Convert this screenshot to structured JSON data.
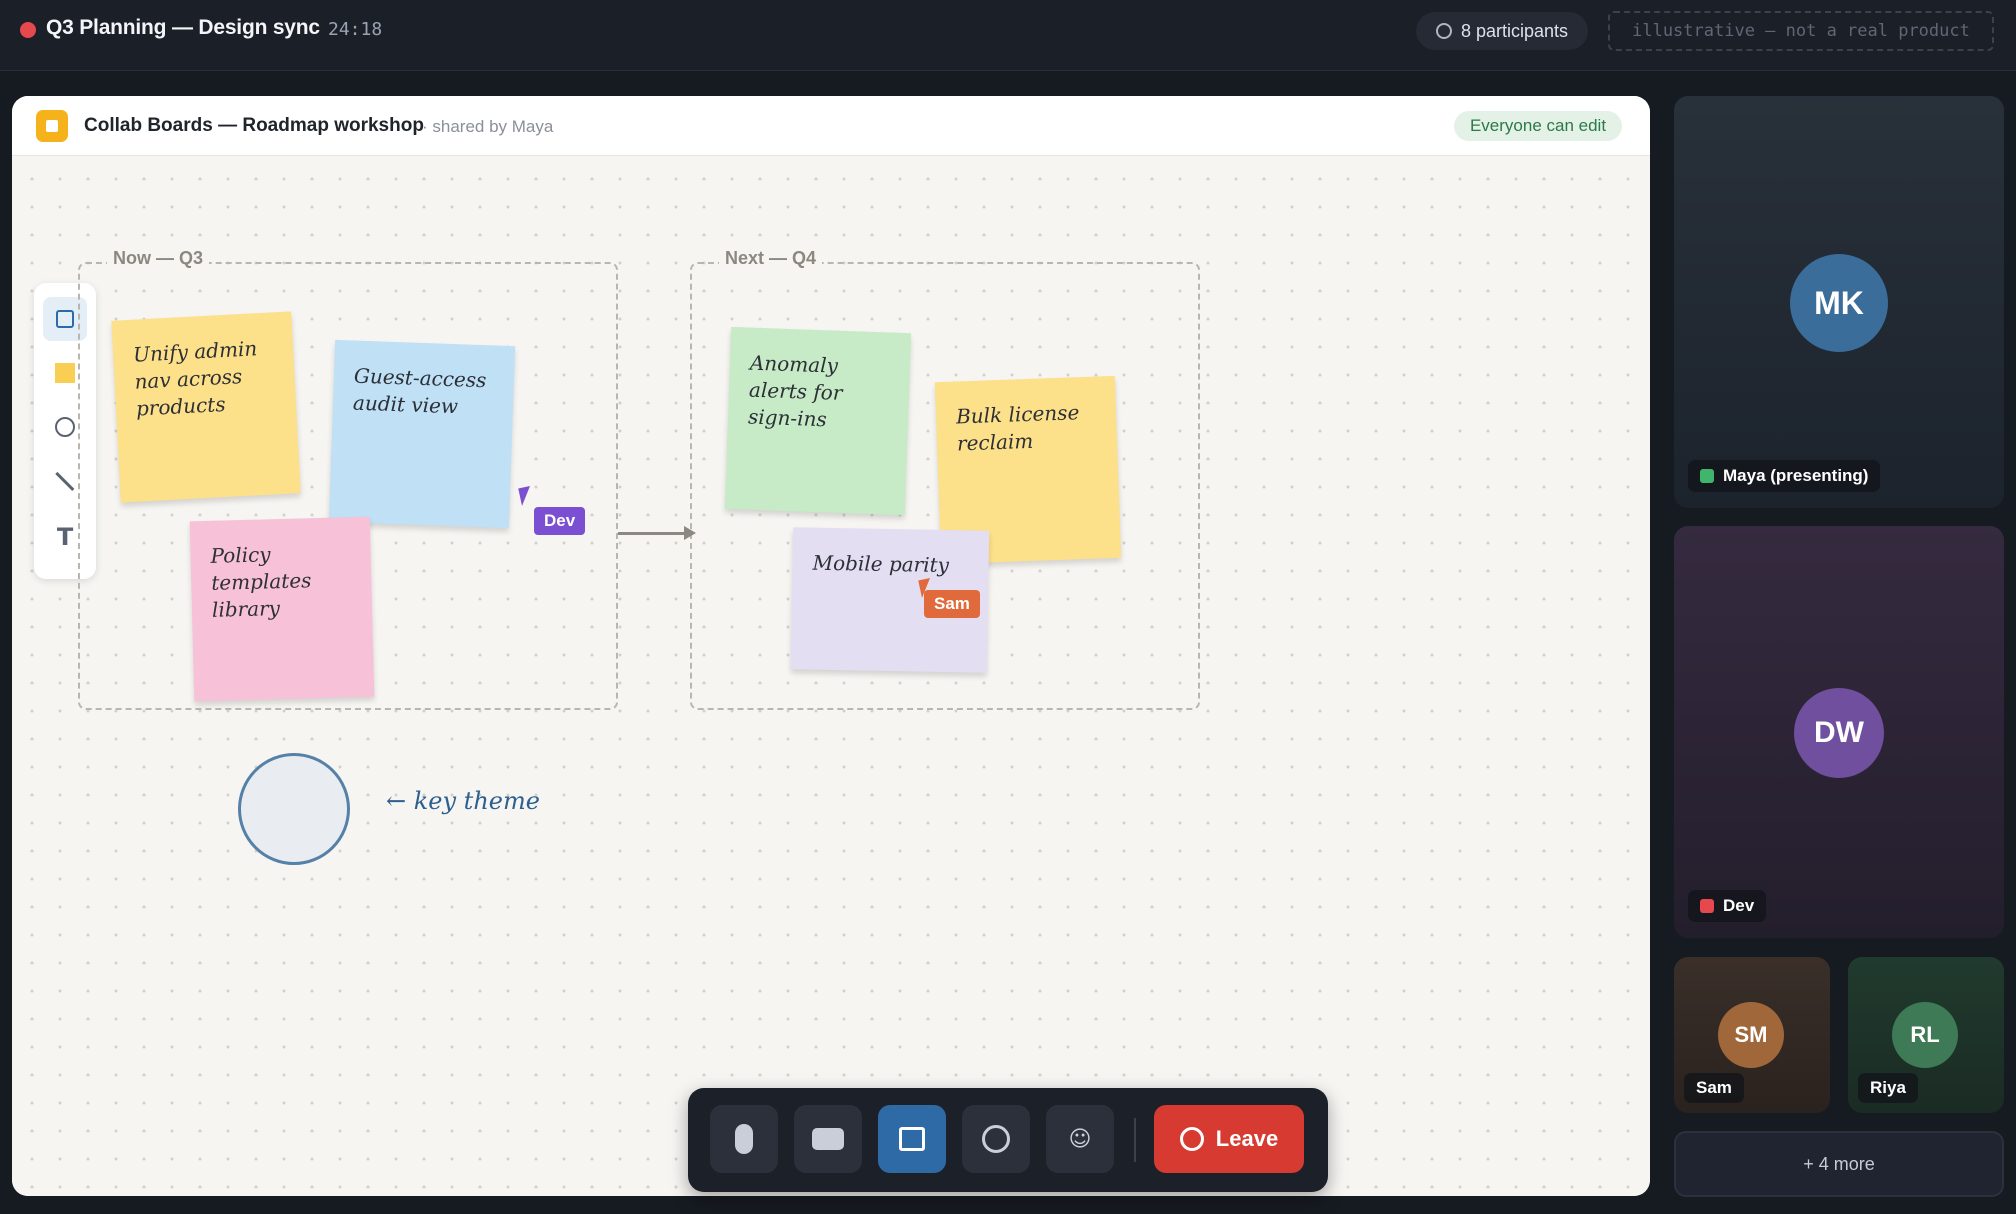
{
  "meeting": {
    "title": "Q3 Planning — Design sync",
    "timer": "24:18",
    "participants": "8 participants",
    "disclaimer": "illustrative – not a real product"
  },
  "board": {
    "title": "Collab Boards — Roadmap workshop",
    "shared_by": "· shared by Maya",
    "permission": "Everyone can edit",
    "tools": [
      "select-icon",
      "sticky-note-icon",
      "circle-icon",
      "line-icon",
      "text-icon"
    ],
    "tool_text_glyph": "T",
    "frames": [
      {
        "label": "Now — Q3"
      },
      {
        "label": "Next — Q4"
      }
    ],
    "stickies": [
      {
        "text": "Unify admin nav across products",
        "color": "#fde08a"
      },
      {
        "text": "Guest-access audit view",
        "color": "#bfe0f5"
      },
      {
        "text": "Policy templates library",
        "color": "#f7c1d7"
      },
      {
        "text": "Anomaly alerts for sign-ins",
        "color": "#c6ebc6"
      },
      {
        "text": "Bulk license reclaim",
        "color": "#fde08a"
      },
      {
        "text": "Mobile parity",
        "color": "#e4def3"
      }
    ],
    "cursors": [
      {
        "name": "Dev",
        "color": "#7b4fd1"
      },
      {
        "name": "Sam",
        "color": "#e06a3b"
      }
    ],
    "annotation": "← key theme"
  },
  "controls": {
    "buttons": [
      "mic-icon",
      "camera-icon",
      "share-screen-icon",
      "record-icon",
      "reactions-icon"
    ],
    "emoji_glyph": "☺",
    "leave_label": "Leave"
  },
  "participants": [
    {
      "initials": "MK",
      "label": "Maya (presenting)",
      "status_color": "#3fb66b",
      "avatar_color": "#3a6d9a"
    },
    {
      "initials": "DW",
      "label": "Dev",
      "status_color": "#e5484d",
      "avatar_color": "#6f4f9e"
    },
    {
      "initials": "SM",
      "label": "Sam",
      "avatar_color": "#a0673a"
    },
    {
      "initials": "RL",
      "label": "Riya",
      "avatar_color": "#3e7a56"
    }
  ],
  "more_label": "+ 4 more"
}
